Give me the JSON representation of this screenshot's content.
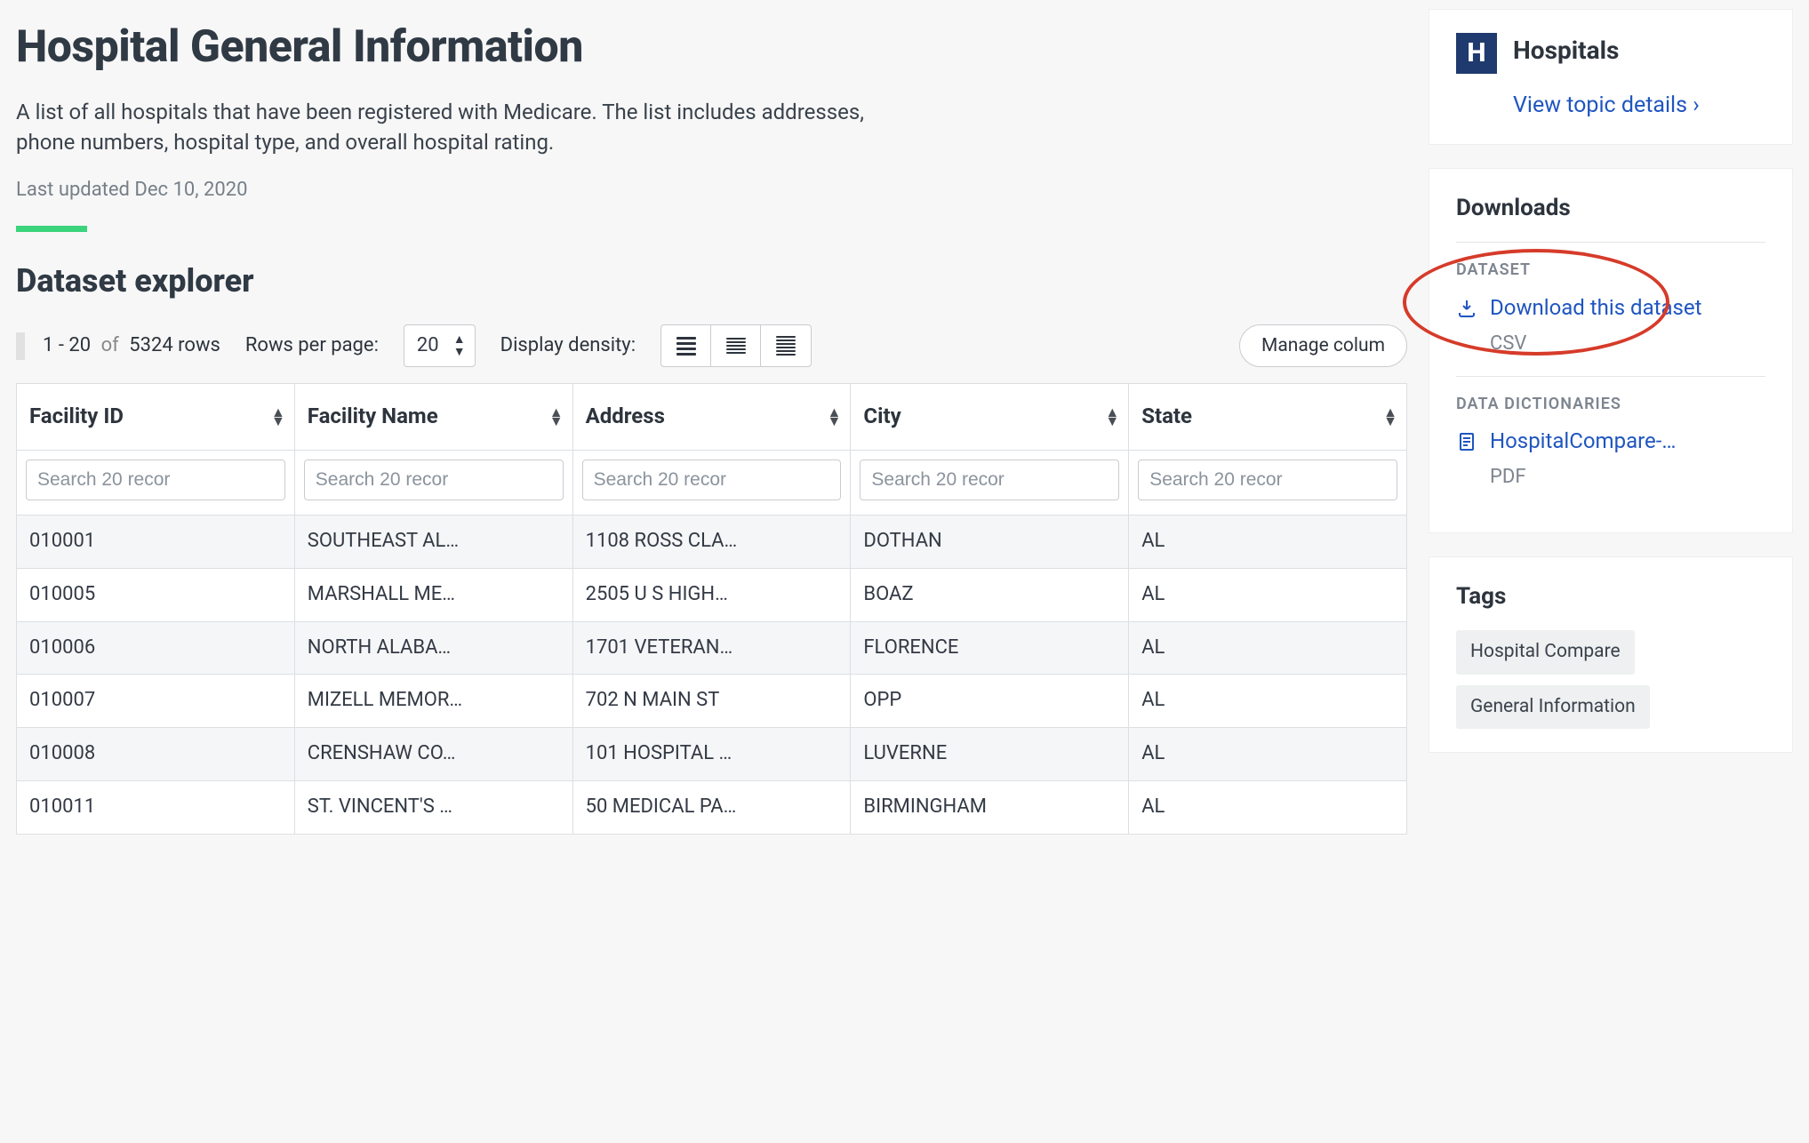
{
  "header": {
    "title": "Hospital General Information",
    "description": "A list of all hospitals that have been registered with Medicare. The list includes addresses, phone numbers, hospital type, and overall hospital rating.",
    "last_updated": "Last updated Dec 10, 2020"
  },
  "explorer": {
    "title": "Dataset explorer",
    "range_start": "1",
    "range_end": "20",
    "of_label": "of",
    "total_rows": "5324 rows",
    "rows_per_page_label": "Rows per page:",
    "rows_per_page_value": "20",
    "display_density_label": "Display density:",
    "manage_columns_label": "Manage colum"
  },
  "table": {
    "columns": [
      "Facility ID",
      "Facility Name",
      "Address",
      "City",
      "State"
    ],
    "search_placeholder": "Search 20 recor",
    "rows": [
      {
        "id": "010001",
        "name": "SOUTHEAST AL…",
        "address": "1108 ROSS CLA…",
        "city": "DOTHAN",
        "state": "AL"
      },
      {
        "id": "010005",
        "name": "MARSHALL ME…",
        "address": "2505 U S HIGH…",
        "city": "BOAZ",
        "state": "AL"
      },
      {
        "id": "010006",
        "name": "NORTH ALABA…",
        "address": "1701 VETERAN…",
        "city": "FLORENCE",
        "state": "AL"
      },
      {
        "id": "010007",
        "name": "MIZELL MEMOR…",
        "address": "702 N MAIN ST",
        "city": "OPP",
        "state": "AL"
      },
      {
        "id": "010008",
        "name": "CRENSHAW CO…",
        "address": "101 HOSPITAL …",
        "city": "LUVERNE",
        "state": "AL"
      },
      {
        "id": "010011",
        "name": "ST. VINCENT'S …",
        "address": "50 MEDICAL PA…",
        "city": "BIRMINGHAM",
        "state": "AL"
      }
    ]
  },
  "sidebar": {
    "topic": {
      "icon_letter": "H",
      "title": "Hospitals",
      "link_label": "View topic details"
    },
    "downloads": {
      "title": "Downloads",
      "dataset_label": "DATASET",
      "download_link": "Download this dataset",
      "download_format": "CSV",
      "dict_label": "DATA DICTIONARIES",
      "dict_link": "HospitalCompare-…",
      "dict_format": "PDF"
    },
    "tags": {
      "title": "Tags",
      "items": [
        "Hospital Compare",
        "General Information"
      ]
    }
  }
}
